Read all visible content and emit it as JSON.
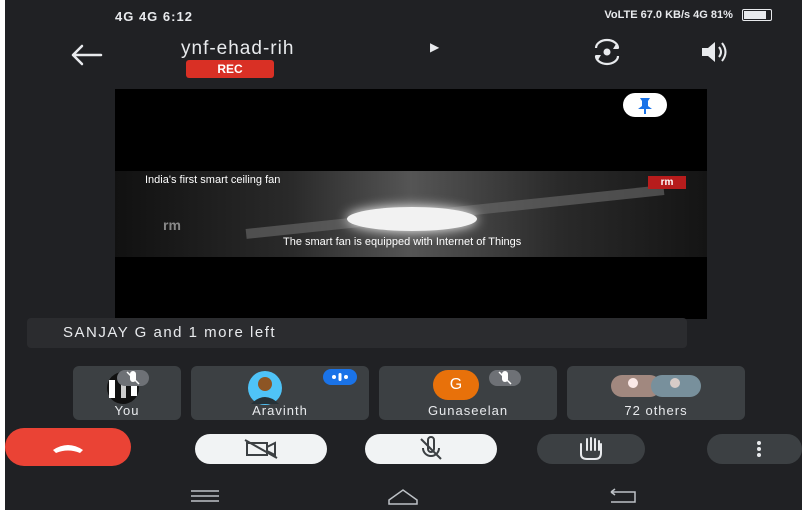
{
  "status_bar": {
    "left_text": "4G 4G 6:12",
    "right_text": "VoLTE 67.0 KB/s 4G 81%"
  },
  "header": {
    "meeting_code": "ynf-ehad-rih",
    "rec_label": "REC"
  },
  "video": {
    "caption_top": "India's first smart ceiling fan",
    "caption_bottom": "The smart fan is equipped with Internet of Things",
    "watermark": "rm",
    "watermark_small": "rm"
  },
  "notice": {
    "text": "SANJAY G and 1 more left"
  },
  "participants": [
    {
      "name": "You"
    },
    {
      "name": "Aravinth"
    },
    {
      "name": "Gunaseelan",
      "initial": "G"
    },
    {
      "name": "72 others"
    }
  ],
  "colors": {
    "background": "#202124",
    "rec": "#d93025",
    "hangup": "#ea4335",
    "initial_avatar": "#e8710a",
    "speaking_badge": "#1a73e8"
  }
}
